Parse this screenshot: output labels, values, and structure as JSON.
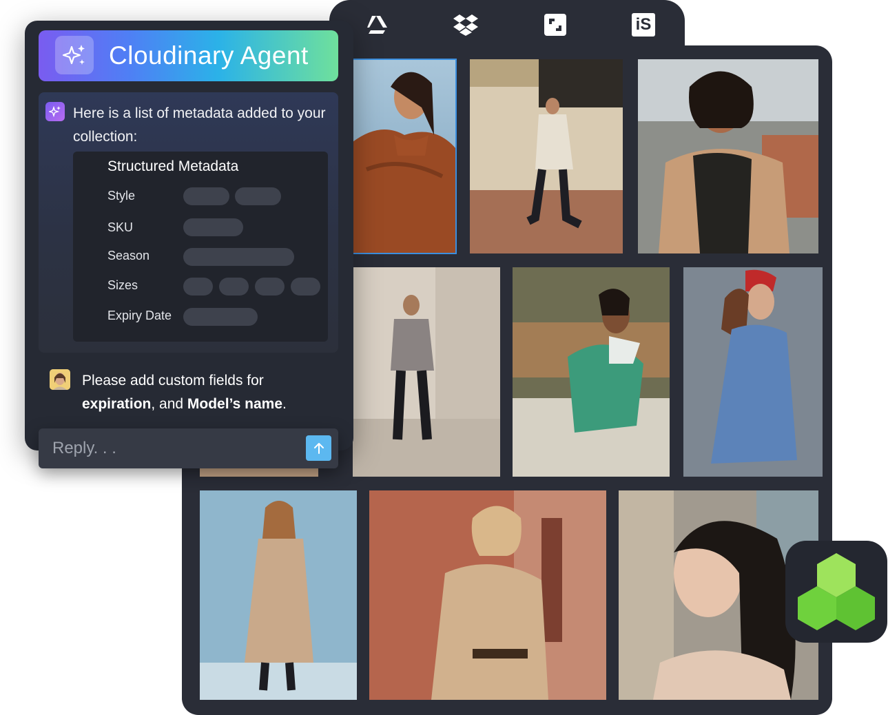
{
  "integrations": [
    {
      "name": "google-drive-icon"
    },
    {
      "name": "dropbox-icon"
    },
    {
      "name": "frame-icon"
    },
    {
      "name": "istock-icon",
      "text": "iS"
    }
  ],
  "agent": {
    "title": "Cloudinary Agent",
    "message": "Here is a list of metadata added to your collection:",
    "metadata": {
      "heading": "Structured Metadata",
      "fields": [
        {
          "label": "Style"
        },
        {
          "label": "SKU"
        },
        {
          "label": "Season"
        },
        {
          "label": "Sizes"
        },
        {
          "label": "Expiry Date"
        }
      ]
    },
    "user_message": {
      "prefix": "Please add custom fields for ",
      "bold1": "expiration",
      "middle": ", and ",
      "bold2": "Model’s name",
      "suffix": "."
    },
    "reply_placeholder": "Reply. . ."
  },
  "colors": {
    "panel": "#2a2d37",
    "selection": "#3b8fe0",
    "send_button": "#5cb8f0",
    "badge_green": "#7ed957"
  }
}
